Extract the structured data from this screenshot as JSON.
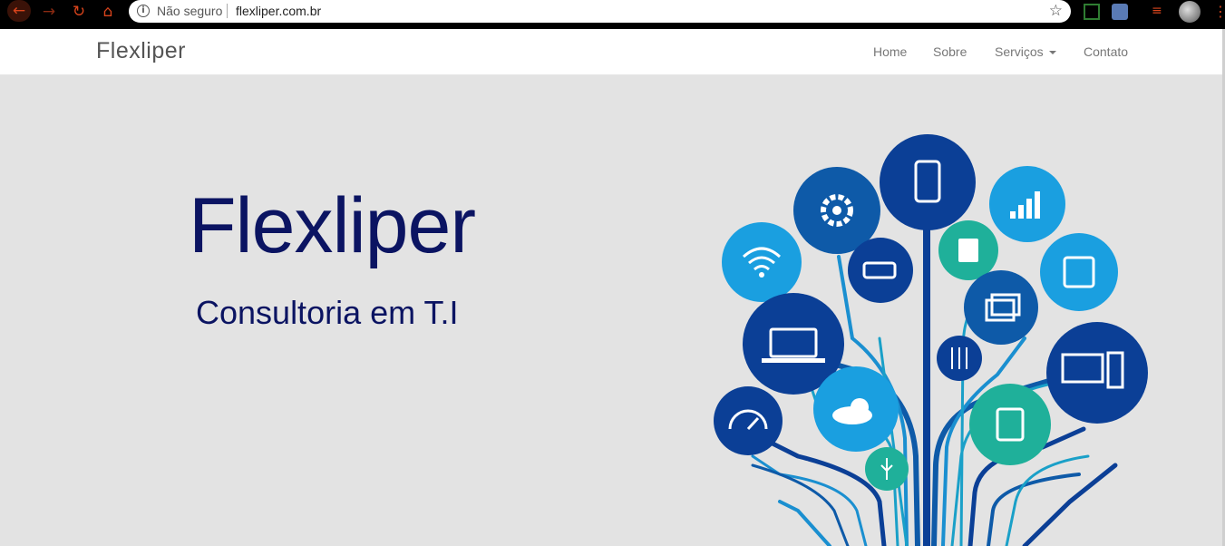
{
  "browser": {
    "security_label": "Não seguro",
    "url": "flexliper.com.br",
    "icons": [
      "back-arrow-icon",
      "forward-arrow-icon",
      "reload-icon",
      "home-icon",
      "info-icon",
      "star-icon",
      "extension-icon",
      "menu-icon"
    ],
    "accent_color": "#d9441c"
  },
  "navbar": {
    "brand": "Flexliper",
    "links": {
      "home": "Home",
      "sobre": "Sobre",
      "servicos": "Serviços",
      "contato": "Contato"
    }
  },
  "hero": {
    "title": "Flexliper",
    "subtitle": "Consultoria em T.I",
    "title_color": "#0b1462",
    "illustration_icons": [
      "gear-icon",
      "smartphone-icon",
      "signal-bars-icon",
      "wifi-icon",
      "sd-card-icon",
      "battery-icon",
      "chip-icon",
      "windows-icon",
      "laptop-icon",
      "sliders-icon",
      "desktop-computer-icon",
      "speedometer-icon",
      "cloud-icon",
      "tablet-icon",
      "usb-icon"
    ]
  }
}
